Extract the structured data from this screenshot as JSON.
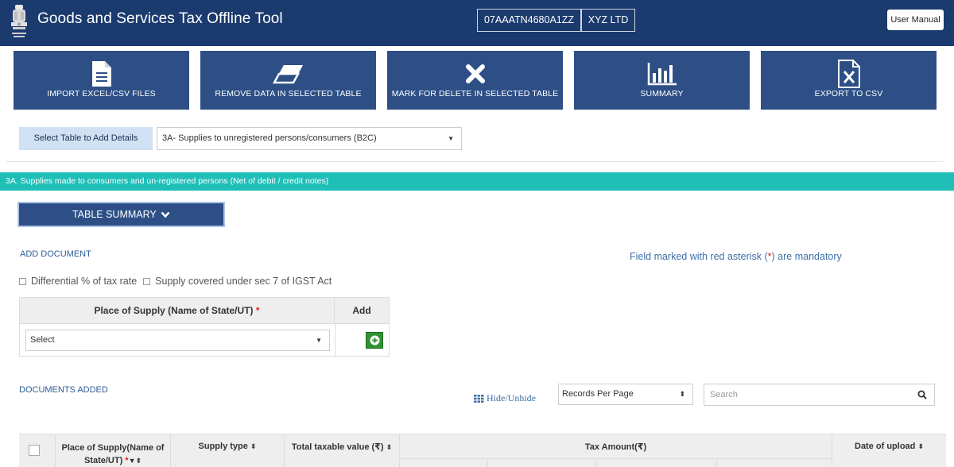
{
  "header": {
    "title": "Goods and Services Tax Offline Tool",
    "gstin": "07AAATN4680A1ZZ",
    "company": "XYZ LTD",
    "user_manual": "User Manual"
  },
  "toolbar": {
    "import": "IMPORT EXCEL/CSV FILES",
    "remove": "REMOVE DATA IN SELECTED TABLE",
    "delete": "MARK FOR DELETE IN SELECTED TABLE",
    "summary": "SUMMARY",
    "export": "EXPORT TO CSV"
  },
  "table_select": {
    "label": "Select Table to Add Details",
    "value": "3A- Supplies to unregistered persons/consumers (B2C)"
  },
  "section": {
    "title": "3A. Supplies made to consumers and un-registered persons (Net of debit / credit notes)",
    "summary_button": "TABLE SUMMARY"
  },
  "add_document": {
    "heading": "ADD DOCUMENT",
    "mandatory_prefix": "Field marked with red asterisk (",
    "asterisk": "*",
    "mandatory_suffix": ") are mandatory",
    "checkbox_1": "Differential % of tax rate",
    "checkbox_2": "Supply covered under sec 7 of IGST Act",
    "col_place": "Place of Supply (Name of State/UT)",
    "col_add": "Add",
    "place_select": "Select"
  },
  "documents": {
    "heading": "DOCUMENTS ADDED",
    "hide_unhide": "Hide/Unhide",
    "records_per_page": "Records Per Page",
    "search_placeholder": "Search",
    "columns": {
      "place_line1": "Place of Supply(Name of",
      "place_line2": "State/UT)",
      "supply_type": "Supply type",
      "taxable_value": "Total taxable value (₹)",
      "tax_amount": "Tax Amount(₹)",
      "date_upload": "Date of upload"
    }
  },
  "colors": {
    "header_bg": "#1b3a6e",
    "button_bg": "#2d4f86",
    "section_bar": "#1fbfb8",
    "add_green": "#2f9332"
  }
}
